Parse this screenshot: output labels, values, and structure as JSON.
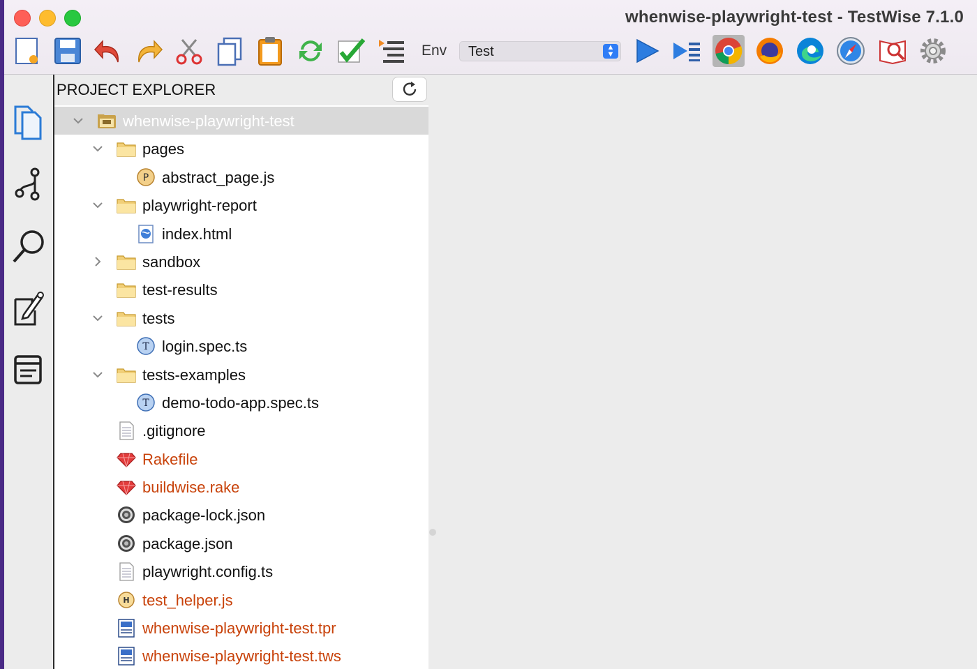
{
  "window": {
    "title": "whenwise-playwright-test - TestWise 7.1.0"
  },
  "toolbar": {
    "env_label": "Env",
    "env_value": "Test",
    "buttons": [
      "new-file-icon",
      "save-icon",
      "undo-icon",
      "redo-icon",
      "cut-icon",
      "copy-icon",
      "paste-icon",
      "refresh-sync-icon",
      "check-icon",
      "outline-icon"
    ],
    "run_buttons": [
      "run-icon",
      "run-all-icon"
    ],
    "browsers": [
      "chrome-icon",
      "firefox-icon",
      "edge-icon",
      "safari-icon",
      "inspect-icon",
      "settings-icon"
    ]
  },
  "activity": [
    "files-icon",
    "git-branch-icon",
    "search-icon",
    "notes-icon",
    "list-icon"
  ],
  "explorer": {
    "title": "PROJECT EXPLORER",
    "items": [
      {
        "label": "whenwise-playwright-test",
        "depth": 0,
        "icon": "project-folder",
        "chevron": "down",
        "selected": true,
        "color": "normal"
      },
      {
        "label": "pages",
        "depth": 1,
        "icon": "folder",
        "chevron": "down",
        "color": "normal"
      },
      {
        "label": "abstract_page.js",
        "depth": 2,
        "icon": "page-file",
        "chevron": "none",
        "color": "normal"
      },
      {
        "label": "playwright-report",
        "depth": 1,
        "icon": "folder",
        "chevron": "down",
        "color": "normal"
      },
      {
        "label": "index.html",
        "depth": 2,
        "icon": "html-file",
        "chevron": "none",
        "color": "normal"
      },
      {
        "label": "sandbox",
        "depth": 1,
        "icon": "folder",
        "chevron": "right",
        "color": "normal"
      },
      {
        "label": "test-results",
        "depth": 1,
        "icon": "folder",
        "chevron": "none",
        "color": "normal"
      },
      {
        "label": "tests",
        "depth": 1,
        "icon": "folder",
        "chevron": "down",
        "color": "normal"
      },
      {
        "label": "login.spec.ts",
        "depth": 2,
        "icon": "test-file",
        "chevron": "none",
        "color": "normal"
      },
      {
        "label": "tests-examples",
        "depth": 1,
        "icon": "folder",
        "chevron": "down",
        "color": "normal"
      },
      {
        "label": "demo-todo-app.spec.ts",
        "depth": 2,
        "icon": "test-file",
        "chevron": "none",
        "color": "normal"
      },
      {
        "label": ".gitignore",
        "depth": 1,
        "icon": "text-file",
        "chevron": "none",
        "color": "normal"
      },
      {
        "label": "Rakefile",
        "depth": 1,
        "icon": "ruby-file",
        "chevron": "none",
        "color": "orange"
      },
      {
        "label": "buildwise.rake",
        "depth": 1,
        "icon": "ruby-file",
        "chevron": "none",
        "color": "orange"
      },
      {
        "label": "package-lock.json",
        "depth": 1,
        "icon": "json-file",
        "chevron": "none",
        "color": "normal"
      },
      {
        "label": "package.json",
        "depth": 1,
        "icon": "json-file",
        "chevron": "none",
        "color": "normal"
      },
      {
        "label": "playwright.config.ts",
        "depth": 1,
        "icon": "text-file",
        "chevron": "none",
        "color": "normal"
      },
      {
        "label": "test_helper.js",
        "depth": 1,
        "icon": "helper-file",
        "chevron": "none",
        "color": "orange"
      },
      {
        "label": "whenwise-playwright-test.tpr",
        "depth": 1,
        "icon": "project-file",
        "chevron": "none",
        "color": "orange"
      },
      {
        "label": "whenwise-playwright-test.tws",
        "depth": 1,
        "icon": "project-file",
        "chevron": "none",
        "color": "orange"
      }
    ]
  }
}
